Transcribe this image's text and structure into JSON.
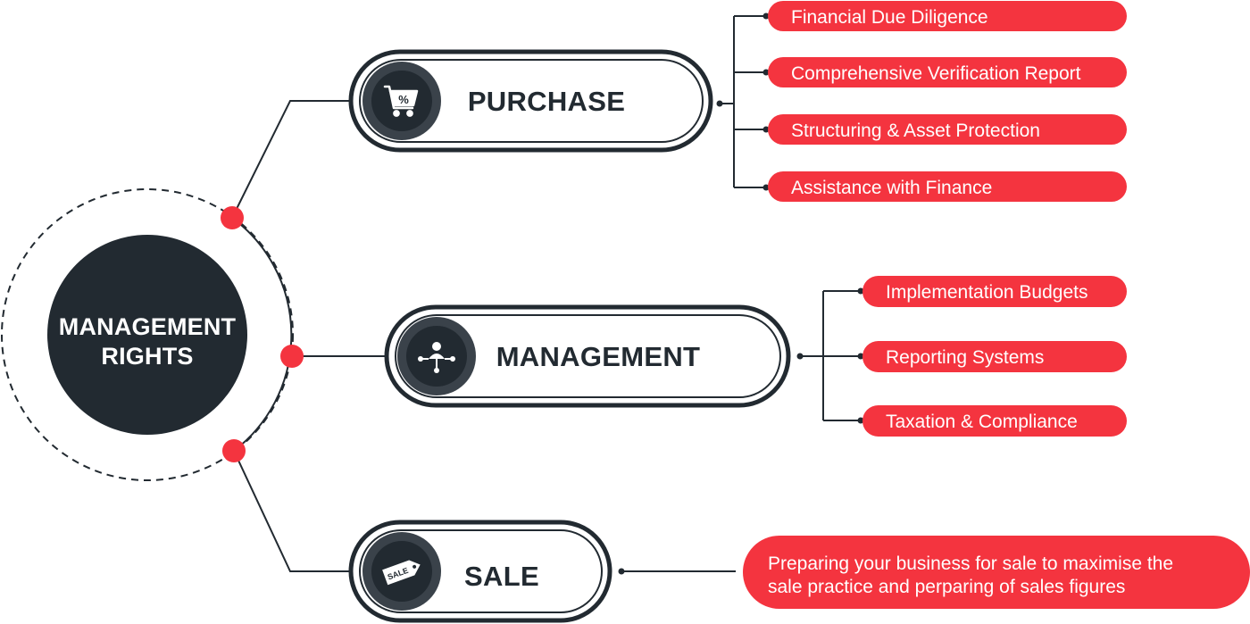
{
  "colors": {
    "dark": "#222a31",
    "icon_ring": "#3a424a",
    "accent_red": "#f4343f",
    "line": "#222a31",
    "white": "#ffffff"
  },
  "center": {
    "line1": "MANAGEMENT",
    "line2": "RIGHTS"
  },
  "branches": {
    "purchase": {
      "label": "PURCHASE",
      "icon": "shopping-cart-percent-icon",
      "items": [
        "Financial Due Diligence",
        "Comprehensive Verification Report",
        "Structuring & Asset Protection",
        "Assistance with Finance"
      ]
    },
    "management": {
      "label": "MANAGEMENT",
      "icon": "network-user-icon",
      "items": [
        "Implementation Budgets",
        "Reporting Systems",
        "Taxation & Compliance"
      ]
    },
    "sale": {
      "label": "SALE",
      "icon": "sale-tag-icon",
      "icon_tag_text": "SALE",
      "description_line1": "Preparing your business for sale to maximise the",
      "description_line2": "sale practice and perparing of sales figures"
    }
  }
}
